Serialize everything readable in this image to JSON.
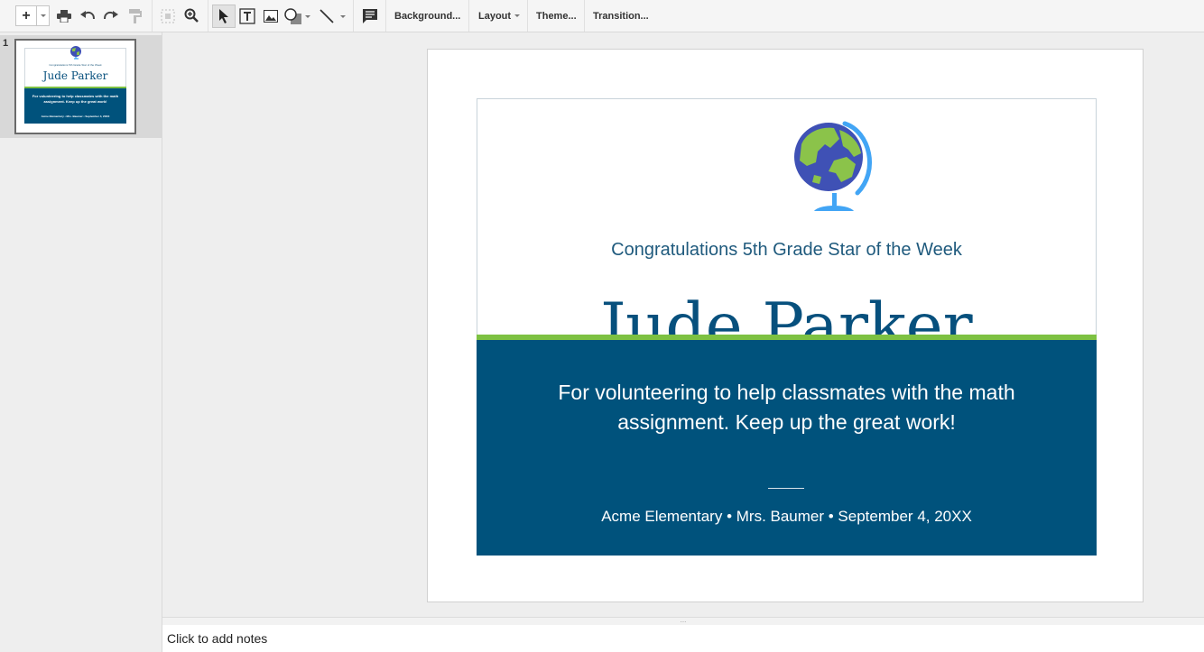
{
  "toolbar": {
    "buttons": {
      "new_slide": "new-slide-icon",
      "print": "print-icon",
      "undo": "undo-icon",
      "redo": "redo-icon",
      "paint_format": "paint-format-icon",
      "zoom_fit": "zoom-fit-icon",
      "zoom": "zoom-icon",
      "select": "select-cursor-icon",
      "text_box": "text-box-icon",
      "image": "image-icon",
      "shape": "shape-icon",
      "line": "line-icon",
      "comment": "comment-icon"
    },
    "background_label": "Background...",
    "layout_label": "Layout",
    "theme_label": "Theme...",
    "transition_label": "Transition..."
  },
  "filmstrip": {
    "slides": [
      {
        "number": "1",
        "subtitle": "Congratulations 5th Grade Star of the Week",
        "name": "Jude Parker",
        "message": "For volunteering to help classmates with the math assignment. Keep up the great work!",
        "footer": "Acme Elementary • Mrs. Baumer • September 4, 20XX"
      }
    ]
  },
  "slide": {
    "icon": "globe-icon",
    "subtitle": "Congratulations 5th Grade Star of the Week",
    "name": "Jude Parker",
    "message": "For volunteering to help classmates with the math assignment. Keep up the great work!",
    "footer": "Acme Elementary • Mrs. Baumer • September 4, 20XX",
    "colors": {
      "primary": "#00527c",
      "accent": "#7dc142",
      "title": "#07507d"
    }
  },
  "notes": {
    "placeholder": "Click to add notes",
    "handle": "..."
  }
}
